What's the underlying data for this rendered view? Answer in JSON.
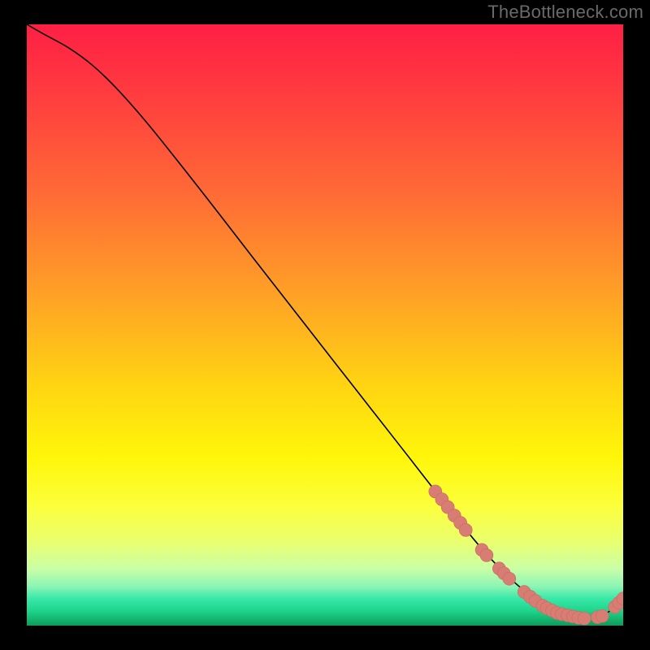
{
  "watermark": "TheBottleneck.com",
  "colors": {
    "black": "#000000",
    "curve": "#000000",
    "marker_fill": "#d87d73",
    "marker_stroke": "#c96a60",
    "watermark": "#6a6a6a",
    "gradient_stops": [
      {
        "offset": 0.0,
        "color": "#ff1f44"
      },
      {
        "offset": 0.12,
        "color": "#ff3d3f"
      },
      {
        "offset": 0.28,
        "color": "#ff6a36"
      },
      {
        "offset": 0.45,
        "color": "#ffa126"
      },
      {
        "offset": 0.6,
        "color": "#ffd412"
      },
      {
        "offset": 0.72,
        "color": "#fff60a"
      },
      {
        "offset": 0.8,
        "color": "#fcff3a"
      },
      {
        "offset": 0.86,
        "color": "#eaff6e"
      },
      {
        "offset": 0.905,
        "color": "#caffa6"
      },
      {
        "offset": 0.935,
        "color": "#8bf5b4"
      },
      {
        "offset": 0.955,
        "color": "#38e8a8"
      },
      {
        "offset": 0.975,
        "color": "#1fd58c"
      },
      {
        "offset": 0.99,
        "color": "#13b46d"
      },
      {
        "offset": 1.0,
        "color": "#0e9b5c"
      }
    ]
  },
  "chart_data": {
    "type": "line",
    "title": "",
    "xlabel": "",
    "ylabel": "",
    "xlim": [
      0,
      100
    ],
    "ylim": [
      0,
      100
    ],
    "grid": false,
    "legend": false,
    "series": [
      {
        "name": "bottleneck-curve",
        "x": [
          0,
          3,
          7,
          11,
          15,
          20,
          26,
          32,
          38,
          45,
          52,
          58,
          64,
          68,
          72,
          75,
          78,
          81,
          84,
          86,
          88,
          90,
          92,
          94,
          96,
          98,
          100
        ],
        "y": [
          100,
          98.3,
          96.1,
          93.2,
          89.4,
          83.8,
          76.4,
          68.8,
          61.1,
          52.2,
          43.3,
          35.7,
          28.1,
          23.0,
          18.0,
          14.3,
          10.9,
          7.9,
          5.3,
          3.8,
          2.7,
          1.9,
          1.4,
          1.2,
          1.5,
          2.6,
          4.5
        ],
        "markers": [
          {
            "x": 68.5,
            "y": 22.3
          },
          {
            "x": 69.6,
            "y": 21.0
          },
          {
            "x": 70.6,
            "y": 19.7
          },
          {
            "x": 71.7,
            "y": 18.3
          },
          {
            "x": 72.7,
            "y": 17.1
          },
          {
            "x": 73.6,
            "y": 15.9
          },
          {
            "x": 76.3,
            "y": 12.6
          },
          {
            "x": 77.1,
            "y": 11.7
          },
          {
            "x": 79.2,
            "y": 9.5
          },
          {
            "x": 80.0,
            "y": 8.7
          },
          {
            "x": 80.9,
            "y": 7.8
          },
          {
            "x": 83.4,
            "y": 5.6
          },
          {
            "x": 84.4,
            "y": 4.8
          },
          {
            "x": 85.3,
            "y": 4.1
          },
          {
            "x": 86.5,
            "y": 3.3
          },
          {
            "x": 87.2,
            "y": 2.9
          },
          {
            "x": 88.1,
            "y": 2.5
          },
          {
            "x": 88.9,
            "y": 2.1
          },
          {
            "x": 89.7,
            "y": 1.9
          },
          {
            "x": 90.7,
            "y": 1.7
          },
          {
            "x": 91.6,
            "y": 1.5
          },
          {
            "x": 92.5,
            "y": 1.3
          },
          {
            "x": 93.5,
            "y": 1.2
          },
          {
            "x": 95.7,
            "y": 1.4
          },
          {
            "x": 96.5,
            "y": 1.6
          },
          {
            "x": 98.6,
            "y": 3.1
          },
          {
            "x": 99.3,
            "y": 3.8
          },
          {
            "x": 100.0,
            "y": 4.5
          }
        ]
      }
    ]
  }
}
